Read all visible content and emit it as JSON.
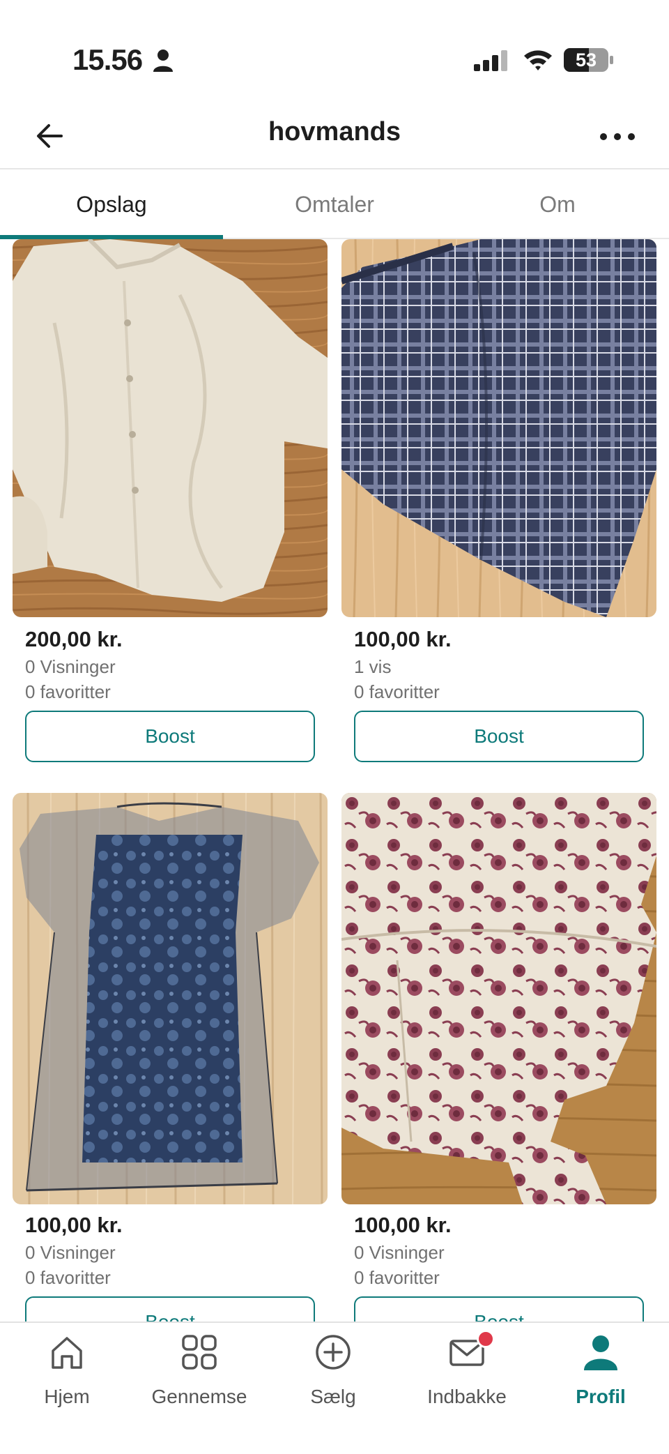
{
  "status_bar": {
    "time": "15.56",
    "battery": "53"
  },
  "header": {
    "title": "hovmands"
  },
  "tabs": [
    {
      "label": "Opslag",
      "active": true
    },
    {
      "label": "Omtaler",
      "active": false
    },
    {
      "label": "Om",
      "active": false
    }
  ],
  "listings": [
    {
      "price": "200,00 kr.",
      "views": "0 Visninger",
      "favorites": "0 favoritter",
      "boost_label": "Boost"
    },
    {
      "price": "100,00 kr.",
      "views": "1 vis",
      "favorites": "0 favoritter",
      "boost_label": "Boost"
    },
    {
      "price": "100,00 kr.",
      "views": "0 Visninger",
      "favorites": "0 favoritter",
      "boost_label": "Boost"
    },
    {
      "price": "100,00 kr.",
      "views": "0 Visninger",
      "favorites": "0 favoritter",
      "boost_label": "Boost"
    }
  ],
  "bottom_nav": [
    {
      "label": "Hjem",
      "icon": "home-icon"
    },
    {
      "label": "Gennemse",
      "icon": "grid-icon"
    },
    {
      "label": "Sælg",
      "icon": "plus-circle-icon"
    },
    {
      "label": "Indbakke",
      "icon": "mail-icon",
      "has_notification": true
    },
    {
      "label": "Profil",
      "icon": "profile-icon",
      "active": true
    }
  ],
  "colors": {
    "accent": "#0e7a7a",
    "notification": "#e0394a"
  }
}
